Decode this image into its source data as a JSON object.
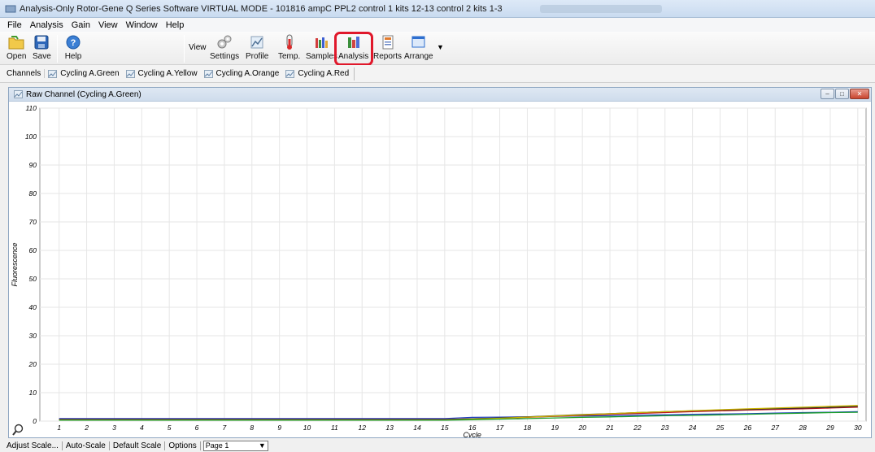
{
  "window": {
    "title": "Analysis-Only Rotor-Gene Q Series Software VIRTUAL MODE - 101816 ampC PPL2 control 1 kits 12-13 control 2 kits 1-3"
  },
  "menu": [
    "File",
    "Analysis",
    "Gain",
    "View",
    "Window",
    "Help"
  ],
  "toolbar": {
    "open": "Open",
    "save": "Save",
    "help": "Help",
    "view": "View",
    "settings": "Settings",
    "profile": "Profile",
    "temp": "Temp.",
    "samples": "Samples",
    "analysis": "Analysis",
    "reports": "Reports",
    "arrange": "Arrange"
  },
  "channels": {
    "label": "Channels",
    "items": [
      "Cycling A.Green",
      "Cycling A.Yellow",
      "Cycling A.Orange",
      "Cycling A.Red"
    ]
  },
  "child_window": {
    "title": "Raw Channel (Cycling A.Green)"
  },
  "statusbar": {
    "adjust_scale": "Adjust Scale...",
    "auto_scale": "Auto-Scale",
    "default_scale": "Default Scale",
    "options": "Options",
    "page_value": "Page 1"
  },
  "colors": {
    "highlight": "#e0182b",
    "grid": "#e6e6e6"
  },
  "chart_data": {
    "type": "line",
    "xlabel": "Cycle",
    "ylabel": "Fluorescence",
    "xlim": [
      0.3,
      30.3
    ],
    "ylim": [
      0,
      110
    ],
    "xticks": [
      1,
      2,
      3,
      4,
      5,
      6,
      7,
      8,
      9,
      10,
      11,
      12,
      13,
      14,
      15,
      16,
      17,
      18,
      19,
      20,
      21,
      22,
      23,
      24,
      25,
      26,
      27,
      28,
      29,
      30
    ],
    "yticks": [
      0,
      10,
      20,
      30,
      40,
      50,
      60,
      70,
      80,
      90,
      100,
      110
    ],
    "grid": true,
    "series": [
      {
        "color": "#1f3fbf",
        "x": [
          1,
          5,
          10,
          15,
          16,
          17,
          18,
          19,
          20,
          21,
          22,
          23,
          24,
          25,
          26,
          27,
          28,
          29,
          30
        ],
        "values": [
          0.9,
          0.9,
          0.9,
          0.9,
          1.3,
          1.4,
          1.5,
          1.7,
          1.8,
          1.9,
          2.1,
          2.2,
          2.4,
          2.5,
          2.6,
          2.8,
          3.0,
          3.1,
          3.3
        ]
      },
      {
        "color": "#c0121f",
        "x": [
          1,
          5,
          10,
          15,
          16,
          17,
          18,
          19,
          20,
          21,
          22,
          23,
          24,
          25,
          26,
          27,
          28,
          29,
          30
        ],
        "values": [
          0.6,
          0.6,
          0.6,
          0.6,
          0.8,
          1.0,
          1.3,
          1.7,
          2.0,
          2.4,
          2.7,
          3.0,
          3.3,
          3.6,
          3.9,
          4.1,
          4.3,
          4.6,
          4.9
        ]
      },
      {
        "color": "#2a2a2a",
        "x": [
          1,
          5,
          10,
          15,
          16,
          17,
          18,
          19,
          20,
          21,
          22,
          23,
          24,
          25,
          26,
          27,
          28,
          29,
          30
        ],
        "values": [
          0.5,
          0.5,
          0.5,
          0.5,
          0.8,
          1.1,
          1.5,
          1.9,
          2.3,
          2.6,
          3.0,
          3.3,
          3.6,
          3.9,
          4.1,
          4.4,
          4.6,
          4.8,
          5.2
        ]
      },
      {
        "color": "#c9b300",
        "x": [
          1,
          5,
          10,
          15,
          16,
          17,
          18,
          19,
          20,
          21,
          22,
          23,
          24,
          25,
          26,
          27,
          28,
          29,
          30
        ],
        "values": [
          0.4,
          0.4,
          0.4,
          0.4,
          0.7,
          1.0,
          1.4,
          1.8,
          2.2,
          2.6,
          3.0,
          3.3,
          3.7,
          4.0,
          4.3,
          4.6,
          4.9,
          5.2,
          5.5
        ]
      },
      {
        "color": "#1a9e2a",
        "x": [
          1,
          5,
          10,
          15,
          16,
          17,
          18,
          19,
          20,
          21,
          22,
          23,
          24,
          25,
          26,
          27,
          28,
          29,
          30
        ],
        "values": [
          0.3,
          0.3,
          0.3,
          0.3,
          0.5,
          0.7,
          0.9,
          1.1,
          1.3,
          1.5,
          1.7,
          1.9,
          2.0,
          2.2,
          2.4,
          2.6,
          2.8,
          3.0,
          3.1
        ]
      }
    ]
  }
}
